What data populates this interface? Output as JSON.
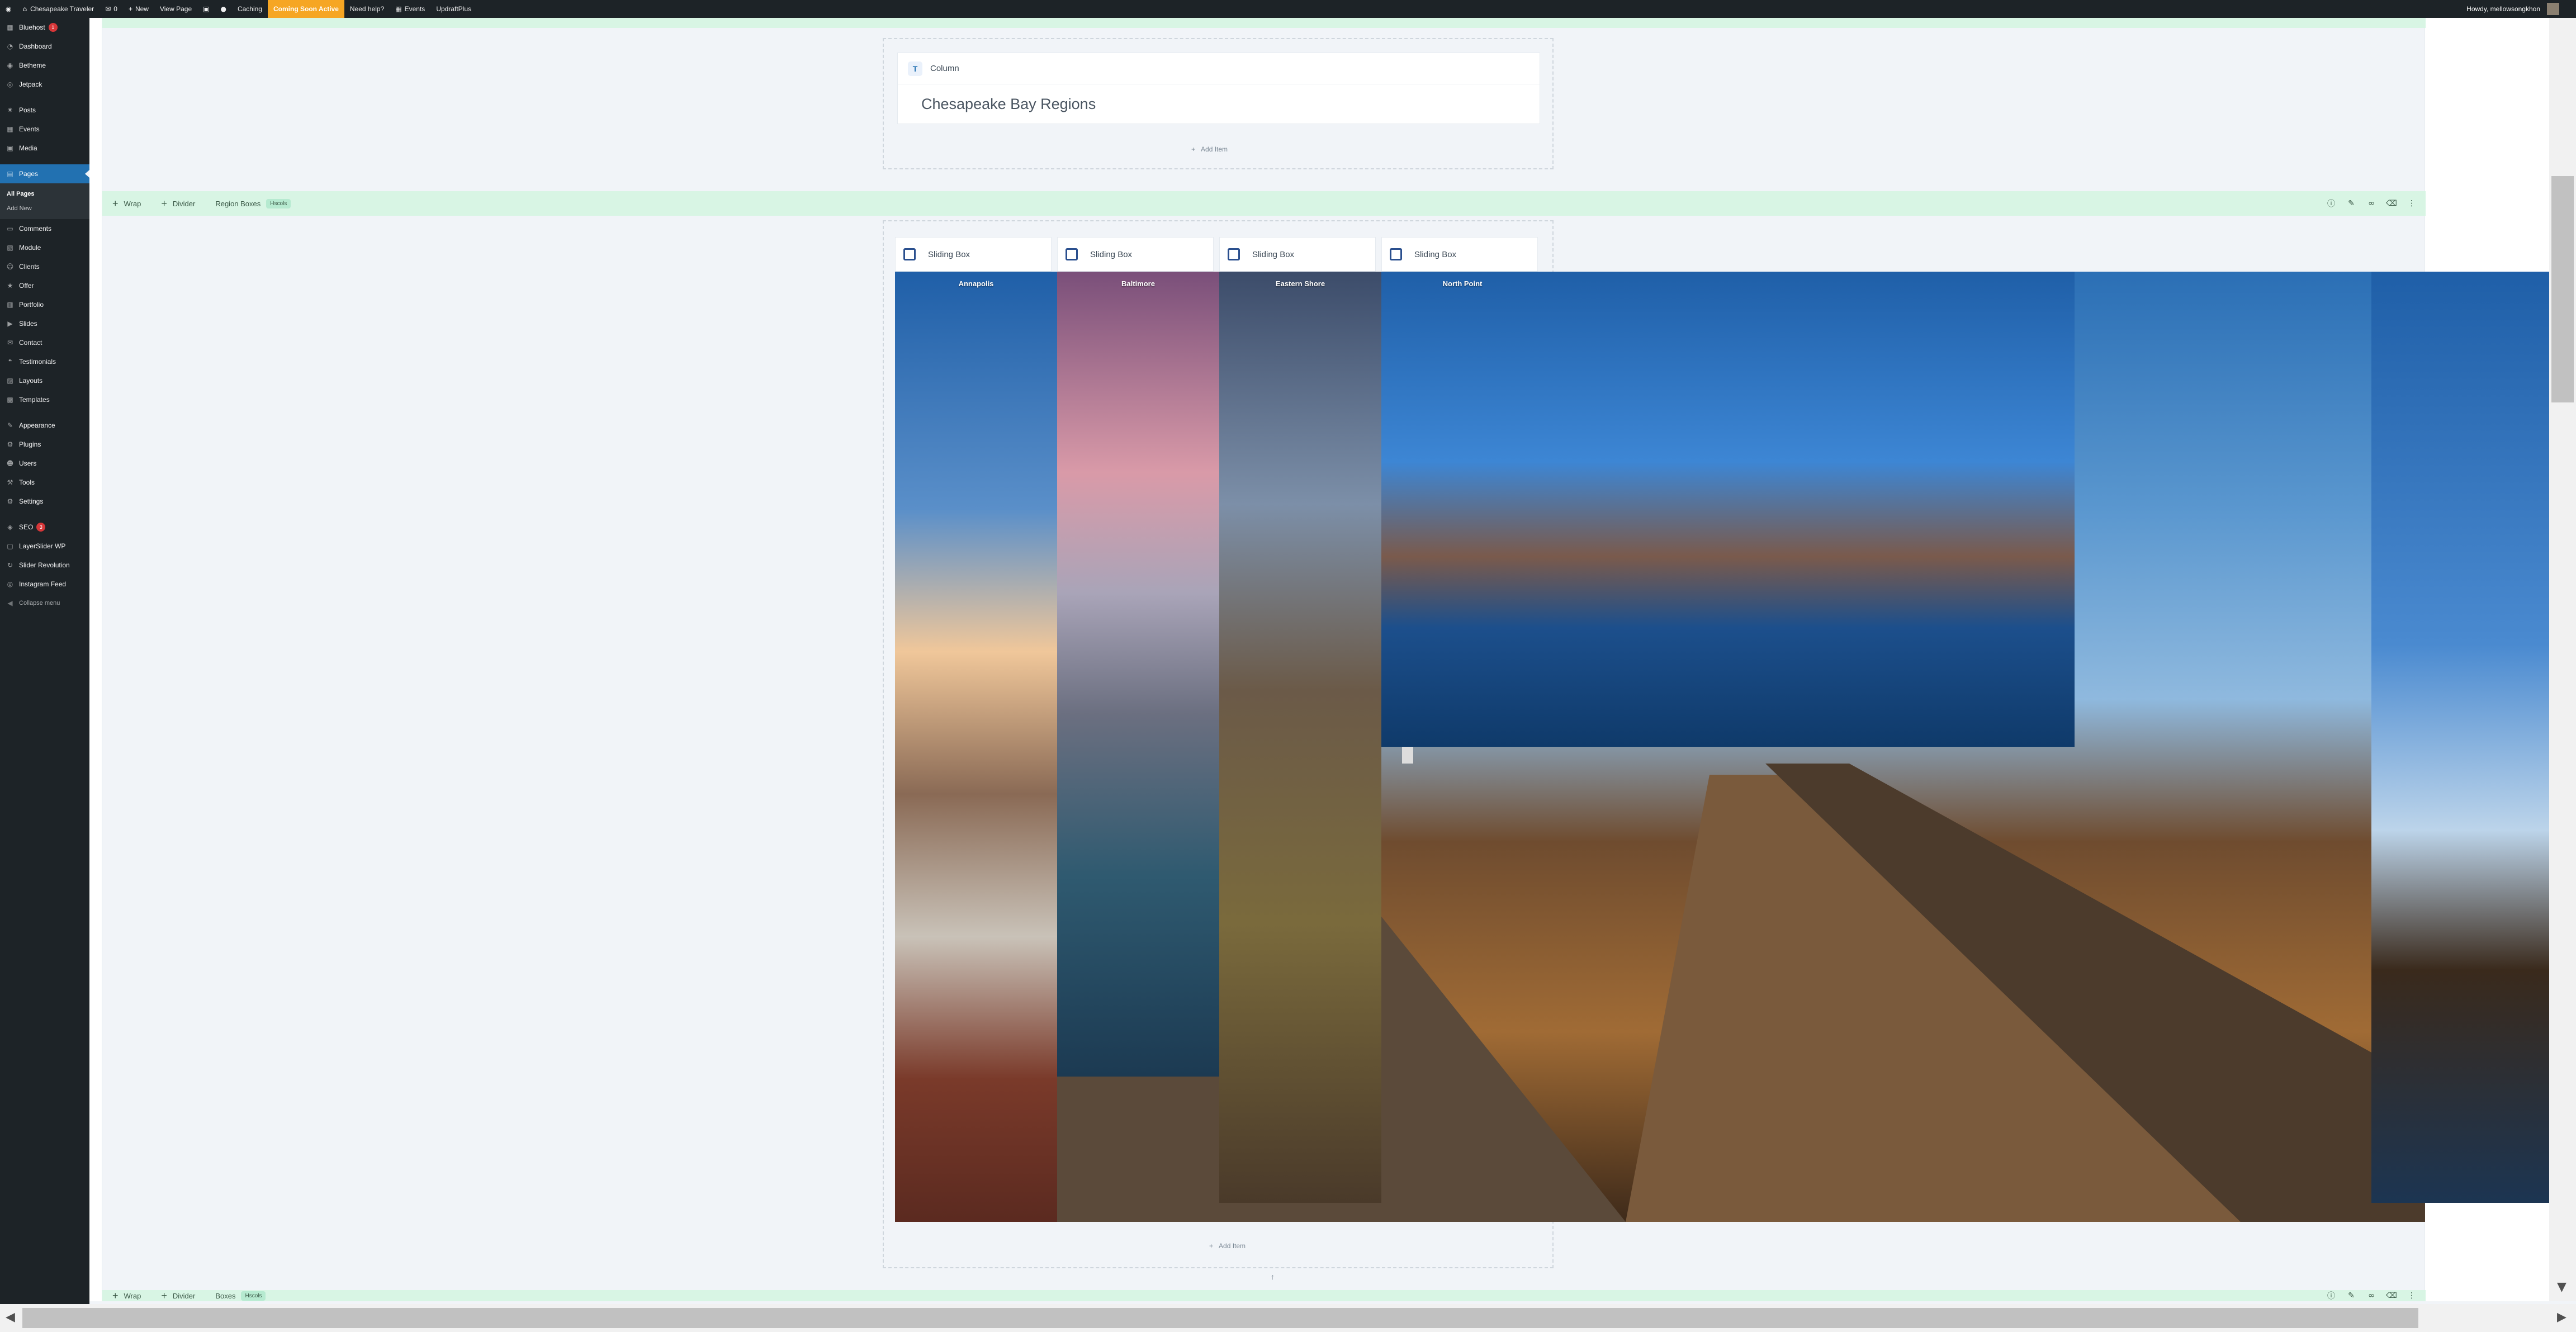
{
  "adminbar": {
    "site_name": "Chesapeake Traveler",
    "comments_count": "0",
    "new_label": "New",
    "view_page_label": "View Page",
    "caching_label": "Caching",
    "coming_soon_label": "Coming Soon Active",
    "need_help_label": "Need help?",
    "events_label": "Events",
    "updraftplus_label": "UpdraftPlus",
    "howdy_label": "Howdy, mellowsongkhon"
  },
  "sidebar": {
    "items": [
      {
        "label": "Bluehost",
        "icon": "bluehost-icon",
        "badge": "1"
      },
      {
        "label": "Dashboard",
        "icon": "dashboard-icon"
      },
      {
        "label": "Betheme",
        "icon": "betheme-icon"
      },
      {
        "label": "Jetpack",
        "icon": "jetpack-icon"
      },
      {
        "label": "Posts",
        "icon": "pin-icon"
      },
      {
        "label": "Events",
        "icon": "calendar-icon"
      },
      {
        "label": "Media",
        "icon": "media-icon"
      },
      {
        "label": "Pages",
        "icon": "pages-icon",
        "active": true
      },
      {
        "label": "Comments",
        "icon": "comments-icon"
      },
      {
        "label": "Module",
        "icon": "module-icon"
      },
      {
        "label": "Clients",
        "icon": "clients-icon"
      },
      {
        "label": "Offer",
        "icon": "offer-icon"
      },
      {
        "label": "Portfolio",
        "icon": "portfolio-icon"
      },
      {
        "label": "Slides",
        "icon": "slides-icon"
      },
      {
        "label": "Contact",
        "icon": "contact-icon"
      },
      {
        "label": "Testimonials",
        "icon": "testimonials-icon"
      },
      {
        "label": "Layouts",
        "icon": "layouts-icon"
      },
      {
        "label": "Templates",
        "icon": "templates-icon"
      },
      {
        "label": "Appearance",
        "icon": "brush-icon"
      },
      {
        "label": "Plugins",
        "icon": "plugin-icon"
      },
      {
        "label": "Users",
        "icon": "users-icon"
      },
      {
        "label": "Tools",
        "icon": "tools-icon"
      },
      {
        "label": "Settings",
        "icon": "settings-icon"
      },
      {
        "label": "SEO",
        "icon": "seo-icon",
        "badge": "3"
      },
      {
        "label": "LayerSlider WP",
        "icon": "layerslider-icon"
      },
      {
        "label": "Slider Revolution",
        "icon": "slider-revolution-icon"
      },
      {
        "label": "Instagram Feed",
        "icon": "instagram-icon"
      }
    ],
    "pages_sub": {
      "all_pages": "All Pages",
      "add_new": "Add New"
    },
    "collapse_label": "Collapse menu"
  },
  "builder": {
    "column_item": {
      "type_label": "Column",
      "heading": "Chesapeake Bay Regions"
    },
    "add_item_label": "Add Item",
    "wrap_label": "Wrap",
    "divider_label": "Divider",
    "region_wrap": {
      "name": "Region Boxes",
      "tag": "Hscols"
    },
    "bottom_wrap": {
      "name": "Boxes",
      "tag": "Hscols"
    },
    "sliding_box_label": "Sliding Box",
    "panels": [
      {
        "label": "Annapolis"
      },
      {
        "label": "Baltimore"
      },
      {
        "label": "Eastern Shore"
      },
      {
        "label": "North Point"
      }
    ]
  }
}
